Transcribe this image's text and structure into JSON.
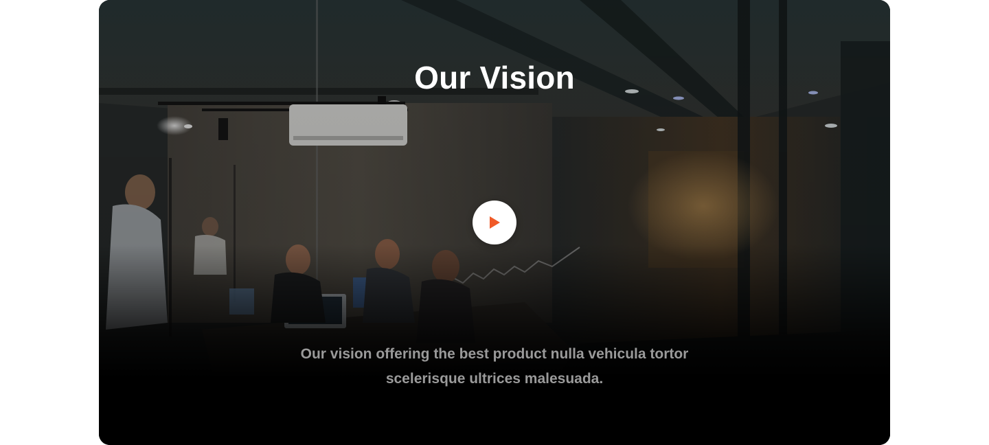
{
  "section": {
    "title": "Our Vision",
    "description": "Our vision offering the best product nulla vehicula tortor scelerisque ultrices malesuada."
  },
  "video": {
    "play_icon": "play-icon",
    "accent_color": "#f05a28"
  },
  "background": {
    "scene": "office-meeting-room-photo"
  }
}
